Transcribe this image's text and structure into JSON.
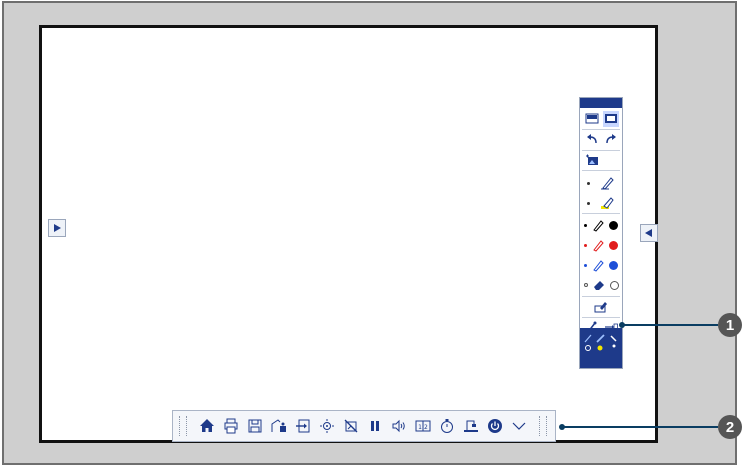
{
  "colors": {
    "frame": "#cfcfcf",
    "accent": "#1e3a8a",
    "callout": "#0a3d62",
    "pen_black": "#000000",
    "pen_red": "#e11d1d",
    "pen_blue": "#1d4fd8",
    "highlighter": "#f2e600"
  },
  "side_buttons": {
    "left": "arrow-right-icon",
    "right": "arrow-left-icon"
  },
  "right_toolbar": {
    "icons": [
      "display-mode-icon",
      "whiteboard-mode-icon",
      "undo-icon",
      "redo-icon",
      "insert-image-icon",
      "pen-icon",
      "highlighter-icon",
      "black-pen-icon",
      "red-pen-icon",
      "blue-pen-icon",
      "eraser-icon",
      "clear-screen-icon",
      "pointer-icon",
      "exit-drawing-icon"
    ]
  },
  "bottom_toolbar": {
    "icons": [
      "home-icon",
      "print-icon",
      "save-icon",
      "share-icon",
      "source-icon",
      "zoom-icon",
      "no-image-icon",
      "freeze-icon",
      "volume-icon",
      "split-screen-icon",
      "timer-icon",
      "document-camera-icon",
      "power-icon",
      "collapse-icon"
    ],
    "split_label": "1|2"
  },
  "callouts": {
    "one": "1",
    "two": "2"
  }
}
